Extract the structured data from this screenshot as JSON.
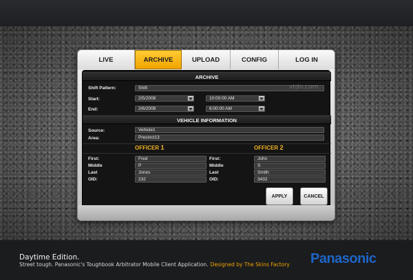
{
  "tabs": [
    {
      "label": "LIVE",
      "active": false
    },
    {
      "label": "ARCHIVE",
      "active": true
    },
    {
      "label": "UPLOAD",
      "active": false
    },
    {
      "label": "CONFIG",
      "active": false
    },
    {
      "label": "LOG IN",
      "active": false
    }
  ],
  "archive": {
    "title": "ARCHIVE",
    "shift_pattern_label": "Shift Pattern:",
    "shift_pattern_value": "Shift",
    "start_label": "Start:",
    "start_date": "2/5/2008",
    "start_time": "10:00:00 AM",
    "end_label": "End:",
    "end_date": "2/6/2008",
    "end_time": "6:00:00 AM"
  },
  "vehicle": {
    "title": "VEHICLE INFORMATION",
    "source_label": "Source:",
    "source_value": "Vehicle1",
    "area_label": "Area:",
    "area_value": "Precinct13"
  },
  "officer1": {
    "title": "OFFICER",
    "number": "1",
    "first_label": "First:",
    "first_value": "Fred",
    "middle_label": "Middle",
    "middle_value": "P",
    "last_label": "Last",
    "last_value": "Jones",
    "oid_label": "OID:",
    "oid_value": "232"
  },
  "officer2": {
    "title": "OFFICER",
    "number": "2",
    "first_label": "First:",
    "first_value": "John",
    "middle_label": "Middle",
    "middle_value": "S",
    "last_label": "Last",
    "last_value": "Smith",
    "oid_label": "OID:",
    "oid_value": "3432"
  },
  "buttons": {
    "apply": "APPLY",
    "cancel": "CANCEL"
  },
  "watermark": "vtdn.com",
  "footer": {
    "edition": "Daytime Edition.",
    "tagline": "Street tough. Panasonic's Toughbook Arbitrator Mobile Client Application.",
    "credit": "Designed by The Skins Factory",
    "brand": "Panasonic"
  },
  "colors": {
    "accent": "#f0a400",
    "brand_blue": "#1e66c8",
    "panel": "#141414"
  },
  "icons": {
    "dropdown": "chevron-down-icon"
  }
}
